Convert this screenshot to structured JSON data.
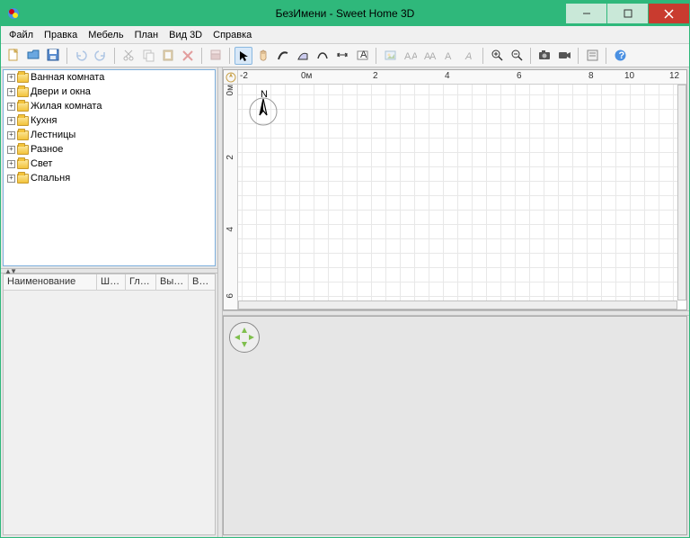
{
  "window": {
    "title": "БезИмени - Sweet Home 3D"
  },
  "menu": {
    "items": [
      "Файл",
      "Правка",
      "Мебель",
      "План",
      "Вид 3D",
      "Справка"
    ]
  },
  "toolbar": {
    "names": [
      "new",
      "open",
      "save",
      "undo",
      "redo",
      "cut",
      "copy",
      "paste",
      "delete",
      "add-furniture",
      "select",
      "create-walls",
      "create-rooms",
      "create-polylines",
      "create-dimensions",
      "create-text",
      "pan",
      "zoom",
      "import-texture",
      "increase-text",
      "decrease-text",
      "bold",
      "italic",
      "magnify-plus",
      "magnify-minus",
      "create-photo",
      "create-video",
      "preferences",
      "help"
    ]
  },
  "catalog": {
    "items": [
      {
        "label": "Ванная комната"
      },
      {
        "label": "Двери и окна"
      },
      {
        "label": "Жилая комната"
      },
      {
        "label": "Кухня"
      },
      {
        "label": "Лестницы"
      },
      {
        "label": "Разное"
      },
      {
        "label": "Свет"
      },
      {
        "label": "Спальня"
      }
    ]
  },
  "furniture_table": {
    "columns": [
      "Наименование",
      "Шир...",
      "Глуб...",
      "Высота",
      "Видимо..."
    ]
  },
  "plan": {
    "ruler_x": [
      "-2",
      "0м",
      "2",
      "4",
      "6",
      "8",
      "10",
      "12"
    ],
    "ruler_y": [
      "0м",
      "2",
      "4",
      "6"
    ],
    "compass_label": "N"
  }
}
